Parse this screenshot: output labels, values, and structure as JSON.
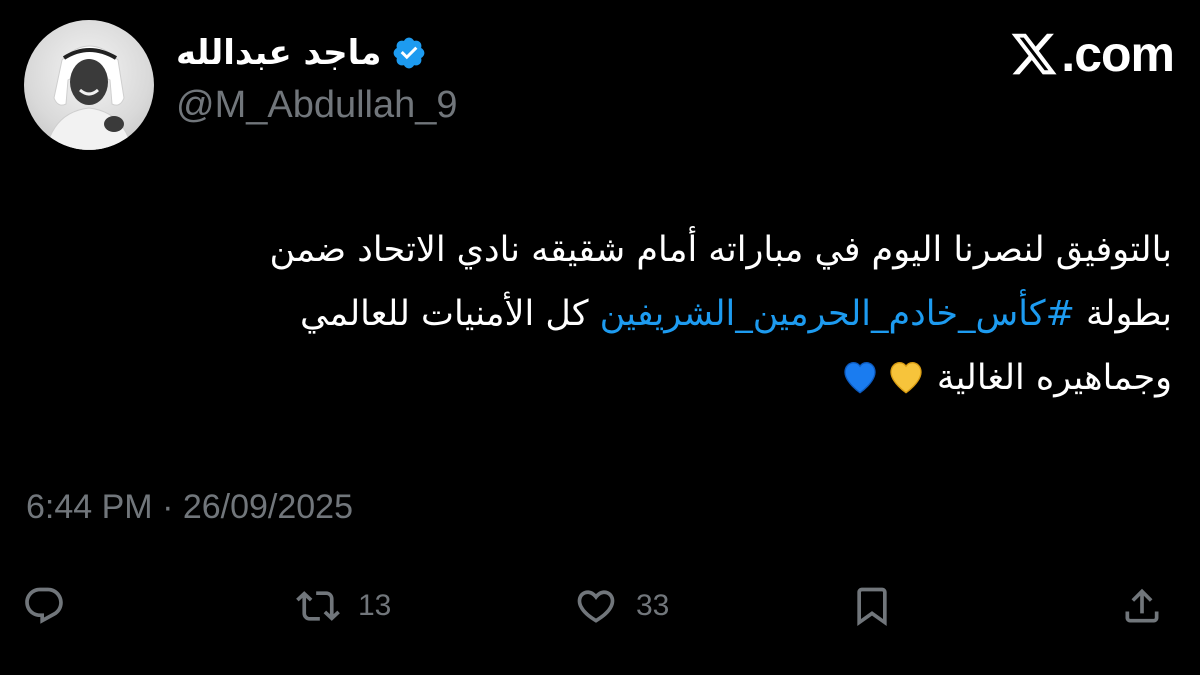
{
  "author": {
    "display_name": "ماجد عبدالله",
    "handle": "@M_Abdullah_9",
    "verified": true,
    "verified_icon": "verified-badge-icon",
    "avatar": "profile-photo"
  },
  "brand": {
    "icon": "x-logo-icon",
    "text": ".com"
  },
  "tweet": {
    "line1": "بالتوفيق لنصرنا اليوم في مباراته أمام شقيقه نادي الاتحاد ضمن",
    "line2_start": "بطولة ",
    "hashtag": "#كأس_خادم_الحرمين_الشريفين",
    "line2_end": " كل الأمنيات للعالمي",
    "line3": "وجماهيره الغالية",
    "emojis": [
      "yellow-heart-icon",
      "blue-heart-icon"
    ]
  },
  "timestamp": "6:44 PM · 26/09/2025",
  "actions": {
    "reply": {
      "icon": "reply-icon"
    },
    "repost": {
      "icon": "repost-icon",
      "count": "13"
    },
    "like": {
      "icon": "heart-outline-icon",
      "count": "33"
    },
    "bookmark": {
      "icon": "bookmark-icon"
    },
    "share": {
      "icon": "share-icon"
    }
  },
  "colors": {
    "background": "#000000",
    "text": "#ffffff",
    "secondary": "#71767b",
    "accent": "#1d9bf0",
    "yellow_heart": "#f7c43b",
    "blue_heart": "#1a7cf0"
  }
}
